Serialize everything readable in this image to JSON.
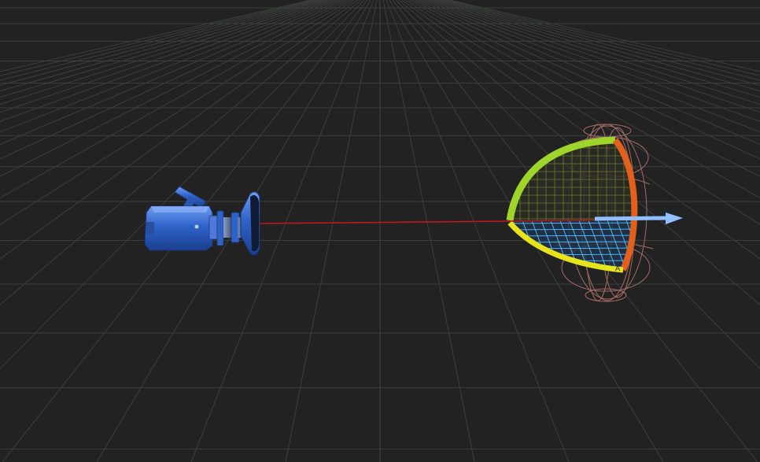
{
  "viewport": {
    "background": "#222222",
    "grid_color": "#3b3f3b"
  },
  "scene": {
    "camera": {
      "icon": "camera-icon",
      "body_color": "#2f63c9",
      "highlight_color": "#6f9cf0"
    },
    "line_of_sight": {
      "color": "#c0181c"
    },
    "direction_arrow": {
      "color": "#8fbfff"
    },
    "gizmo": {
      "outer_arc_color": "#9fd42a",
      "inner_arc_color": "#e8e41c",
      "side_arc_color": "#e2601b",
      "grid_color": "#56c2ff",
      "sphere_wire_color": "#a56a66",
      "axis_letters": [
        "A"
      ]
    }
  }
}
